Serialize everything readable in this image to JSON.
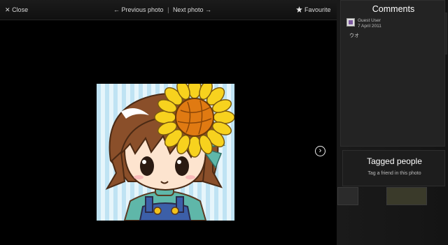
{
  "toolbar": {
    "close_label": "Close",
    "previous_label": "Previous photo",
    "separator": "|",
    "next_label": "Next photo",
    "favourite_label": "Favourite"
  },
  "viewer": {
    "next_button_icon": "chevron-right-icon"
  },
  "comments": {
    "title": "Comments",
    "items": [
      {
        "user": "Guest User",
        "date": "7 April 2011",
        "text": "ウオ"
      }
    ]
  },
  "tagged": {
    "title": "Tagged people",
    "tag_link": "Tag a friend in this photo"
  },
  "colors": {
    "background": "#000000",
    "panel": "#232323",
    "text": "#dddddd",
    "accent": "#ffffff"
  }
}
